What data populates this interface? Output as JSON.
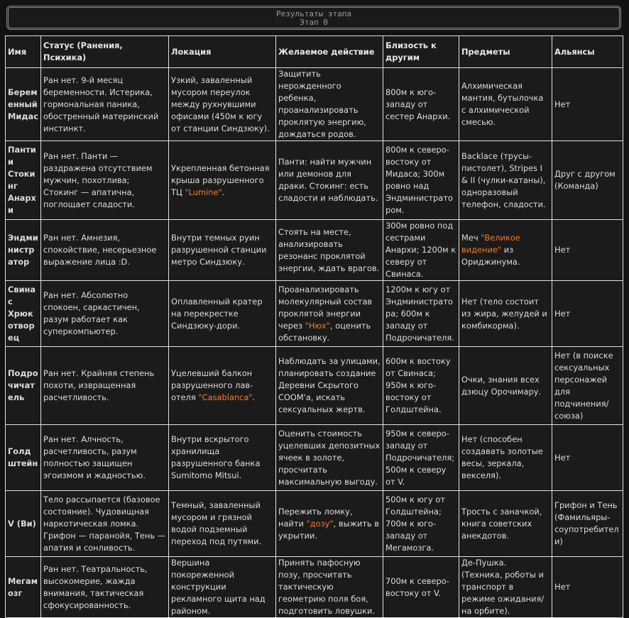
{
  "header": {
    "title": "Результаты этапа",
    "subtitle": "Этап 0"
  },
  "table": {
    "columns": [
      "Имя",
      "Статус (Ранения, Психика)",
      "Локация",
      "Желаемое действие",
      "Близость к другим",
      "Предметы",
      "Альянсы"
    ],
    "rows": [
      {
        "name": "Беременный Мидас",
        "status": "Ран нет. 9-й месяц беременности. Истерика, гормональная паника, обостренный материнский инстинкт.",
        "location": "Узкий, заваленный мусором переулок между рухнувшими офисами (450м к югу от станции Синдзюку).",
        "action": "Защитить нерожденного ребенка, проанализировать проклятую энергию, дождаться родов.",
        "proximity": "800м к юго-западу от сестер Анархи.",
        "items": "Алхимическая мантия, бутылочка с алхимической смесью.",
        "alliance": "Нет"
      },
      {
        "name": "Панти и Стокинг Анархи",
        "status": "Ран нет. Панти — раздражена отсутствием мужчин, похотлива; Стокинг — апатична, поглощает сладости.",
        "location_pre": "Укрепленная бетонная крыша разрушенного ТЦ ",
        "location_hl": "\"Lumine\"",
        "location_post": ".",
        "action": "Панти: найти мужчин или демонов для драки. Стокинг: есть сладости и наблюдать.",
        "proximity": "800м к северо-востоку от Мидаса; 300м ровно над Эндминистратором.",
        "items": "Backlace (трусы-пистолет), Stripes I & II (чулки-катаны), одноразовый телефон, сладости.",
        "alliance": "Друг с другом (Команда)"
      },
      {
        "name": "Эндминистратор",
        "status": "Ран нет. Амнезия, спокойствие, несерьезное выражение лица :D.",
        "location": "Внутри темных руин разрушенной станции метро Синдзюку.",
        "action": "Стоять на месте, анализировать резонанс проклятой энергии, ждать врагов.",
        "proximity": "300м ровно под сестрами Анархи; 1200м к северу от Свинаса.",
        "items_pre": "Меч ",
        "items_hl": "\"Великое видение\"",
        "items_post": " из Ориджинума.",
        "alliance": "Нет"
      },
      {
        "name": "Свинас Хрюкотворец",
        "status": "Ран нет. Абсолютно спокоен, саркастичен, разум работает как суперкомпьютер.",
        "location": "Оплавленный кратер на перекрестке Синдзюку-дори.",
        "action_pre": "Проанализировать молекулярный состав проклятой энергии через ",
        "action_hl": "\"Нюх\"",
        "action_post": ", оценить обстановку.",
        "proximity": "1200м к югу от Эндминистратора; 600м к западу от Подрочичателя.",
        "items": "Нет (тело состоит из жира, желудей и комбикорма).",
        "alliance": "Нет"
      },
      {
        "name": "Подрочичатель",
        "status": "Ран нет. Крайняя степень похоти, извращенная расчетливость.",
        "location_pre": "Уцелевший балкон разрушенного лав-отеля ",
        "location_hl": "\"Casablanca\"",
        "location_post": ".",
        "action": "Наблюдать за улицами, планировать создание Деревни Скрытого COOM'а, искать сексуальных жертв.",
        "proximity": "600м к востоку от Свинаса; 950м к юго-востоку от Голдштейна.",
        "items": "Очки, знания всех дзюцу Орочимару.",
        "alliance": "Нет (в поиске сексуальных персонажей для подчинения/союза)"
      },
      {
        "name": "Голдштейн",
        "status": "Ран нет. Алчность, расчетливость, разум полностью защищен эгоизмом и жадностью.",
        "location": "Внутри вскрытого хранилища разрушенного банка Sumitomo Mitsui.",
        "action": "Оценить стоимость уцелевших депозитных ячеек в золоте, просчитать максимальную выгоду.",
        "proximity": "950м к северо-западу от Подрочичателя; 500м к северу от V.",
        "items": "Нет (способен создавать золотые весы, зеркала, векселя).",
        "alliance": "Нет"
      },
      {
        "name": "V (Ви)",
        "status": "Тело рассыпается (базовое состояние). Чудовищная наркотическая ломка. Грифон — паранойя, Тень — апатия и сонливость.",
        "location": "Темный, заваленный мусором и грязной водой подземный переход под путями.",
        "action_pre": "Пережить ломку, найти ",
        "action_hl": "\"дозу\"",
        "action_post": ", выжить в укрытии.",
        "proximity": "500м к югу от Голдштейна; 700м к юго-западу от Мегамозга.",
        "items": "Трость с заначкой, книга советских анекдотов.",
        "alliance": "Грифон и Тень (Фамильяры-соупотребители)"
      },
      {
        "name": "Мегамозг",
        "status": "Ран нет. Театральность, высокомерие, жажда внимания, тактическая сфокусированность.",
        "location": "Вершина покореженной конструкции рекламного щита над районом.",
        "action": "Принять пафосную позу, просчитать тактическую геометрию поля боя, подготовить ловушки.",
        "proximity": "700м к северо-востоку от V.",
        "items": "Де-Пушка. (Техника, роботы и транспорт в режиме ожидания/на орбите).",
        "alliance": "Нет"
      }
    ]
  }
}
